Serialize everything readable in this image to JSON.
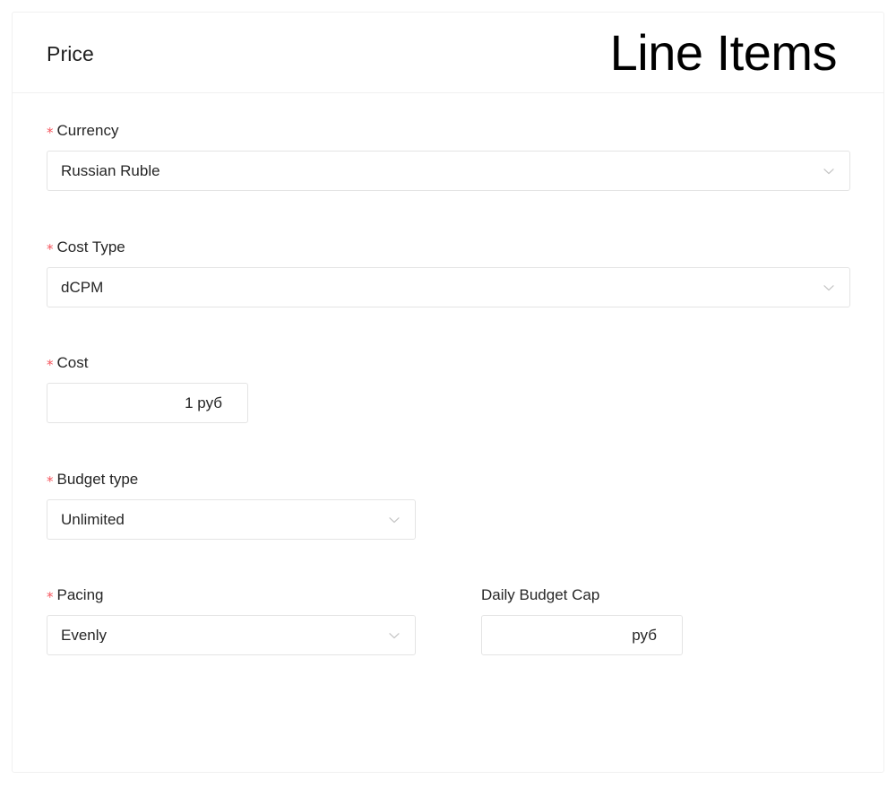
{
  "header": {
    "title": "Price",
    "extra_title": "Line Items"
  },
  "colors": {
    "required_asterisk": "#f5555d",
    "border": "#e4e4e4",
    "divider": "#f0f0f0",
    "text": "#262626",
    "chevron": "#bfbfbf"
  },
  "icons": {
    "chevron": "chevron-down-icon"
  },
  "form": {
    "required_marker": "*",
    "fields": {
      "currency": {
        "label": "Currency",
        "required": true,
        "value": "Russian Ruble",
        "type": "select"
      },
      "cost_type": {
        "label": "Cost Type",
        "required": true,
        "value": "dCPM",
        "type": "select"
      },
      "cost": {
        "label": "Cost",
        "required": true,
        "value": "1 руб",
        "type": "text"
      },
      "budget_type": {
        "label": "Budget type",
        "required": true,
        "value": "Unlimited",
        "type": "select"
      },
      "pacing": {
        "label": "Pacing",
        "required": true,
        "value": "Evenly",
        "type": "select"
      },
      "daily_budget_cap": {
        "label": "Daily Budget Cap",
        "required": false,
        "value": "руб",
        "type": "text"
      }
    }
  }
}
